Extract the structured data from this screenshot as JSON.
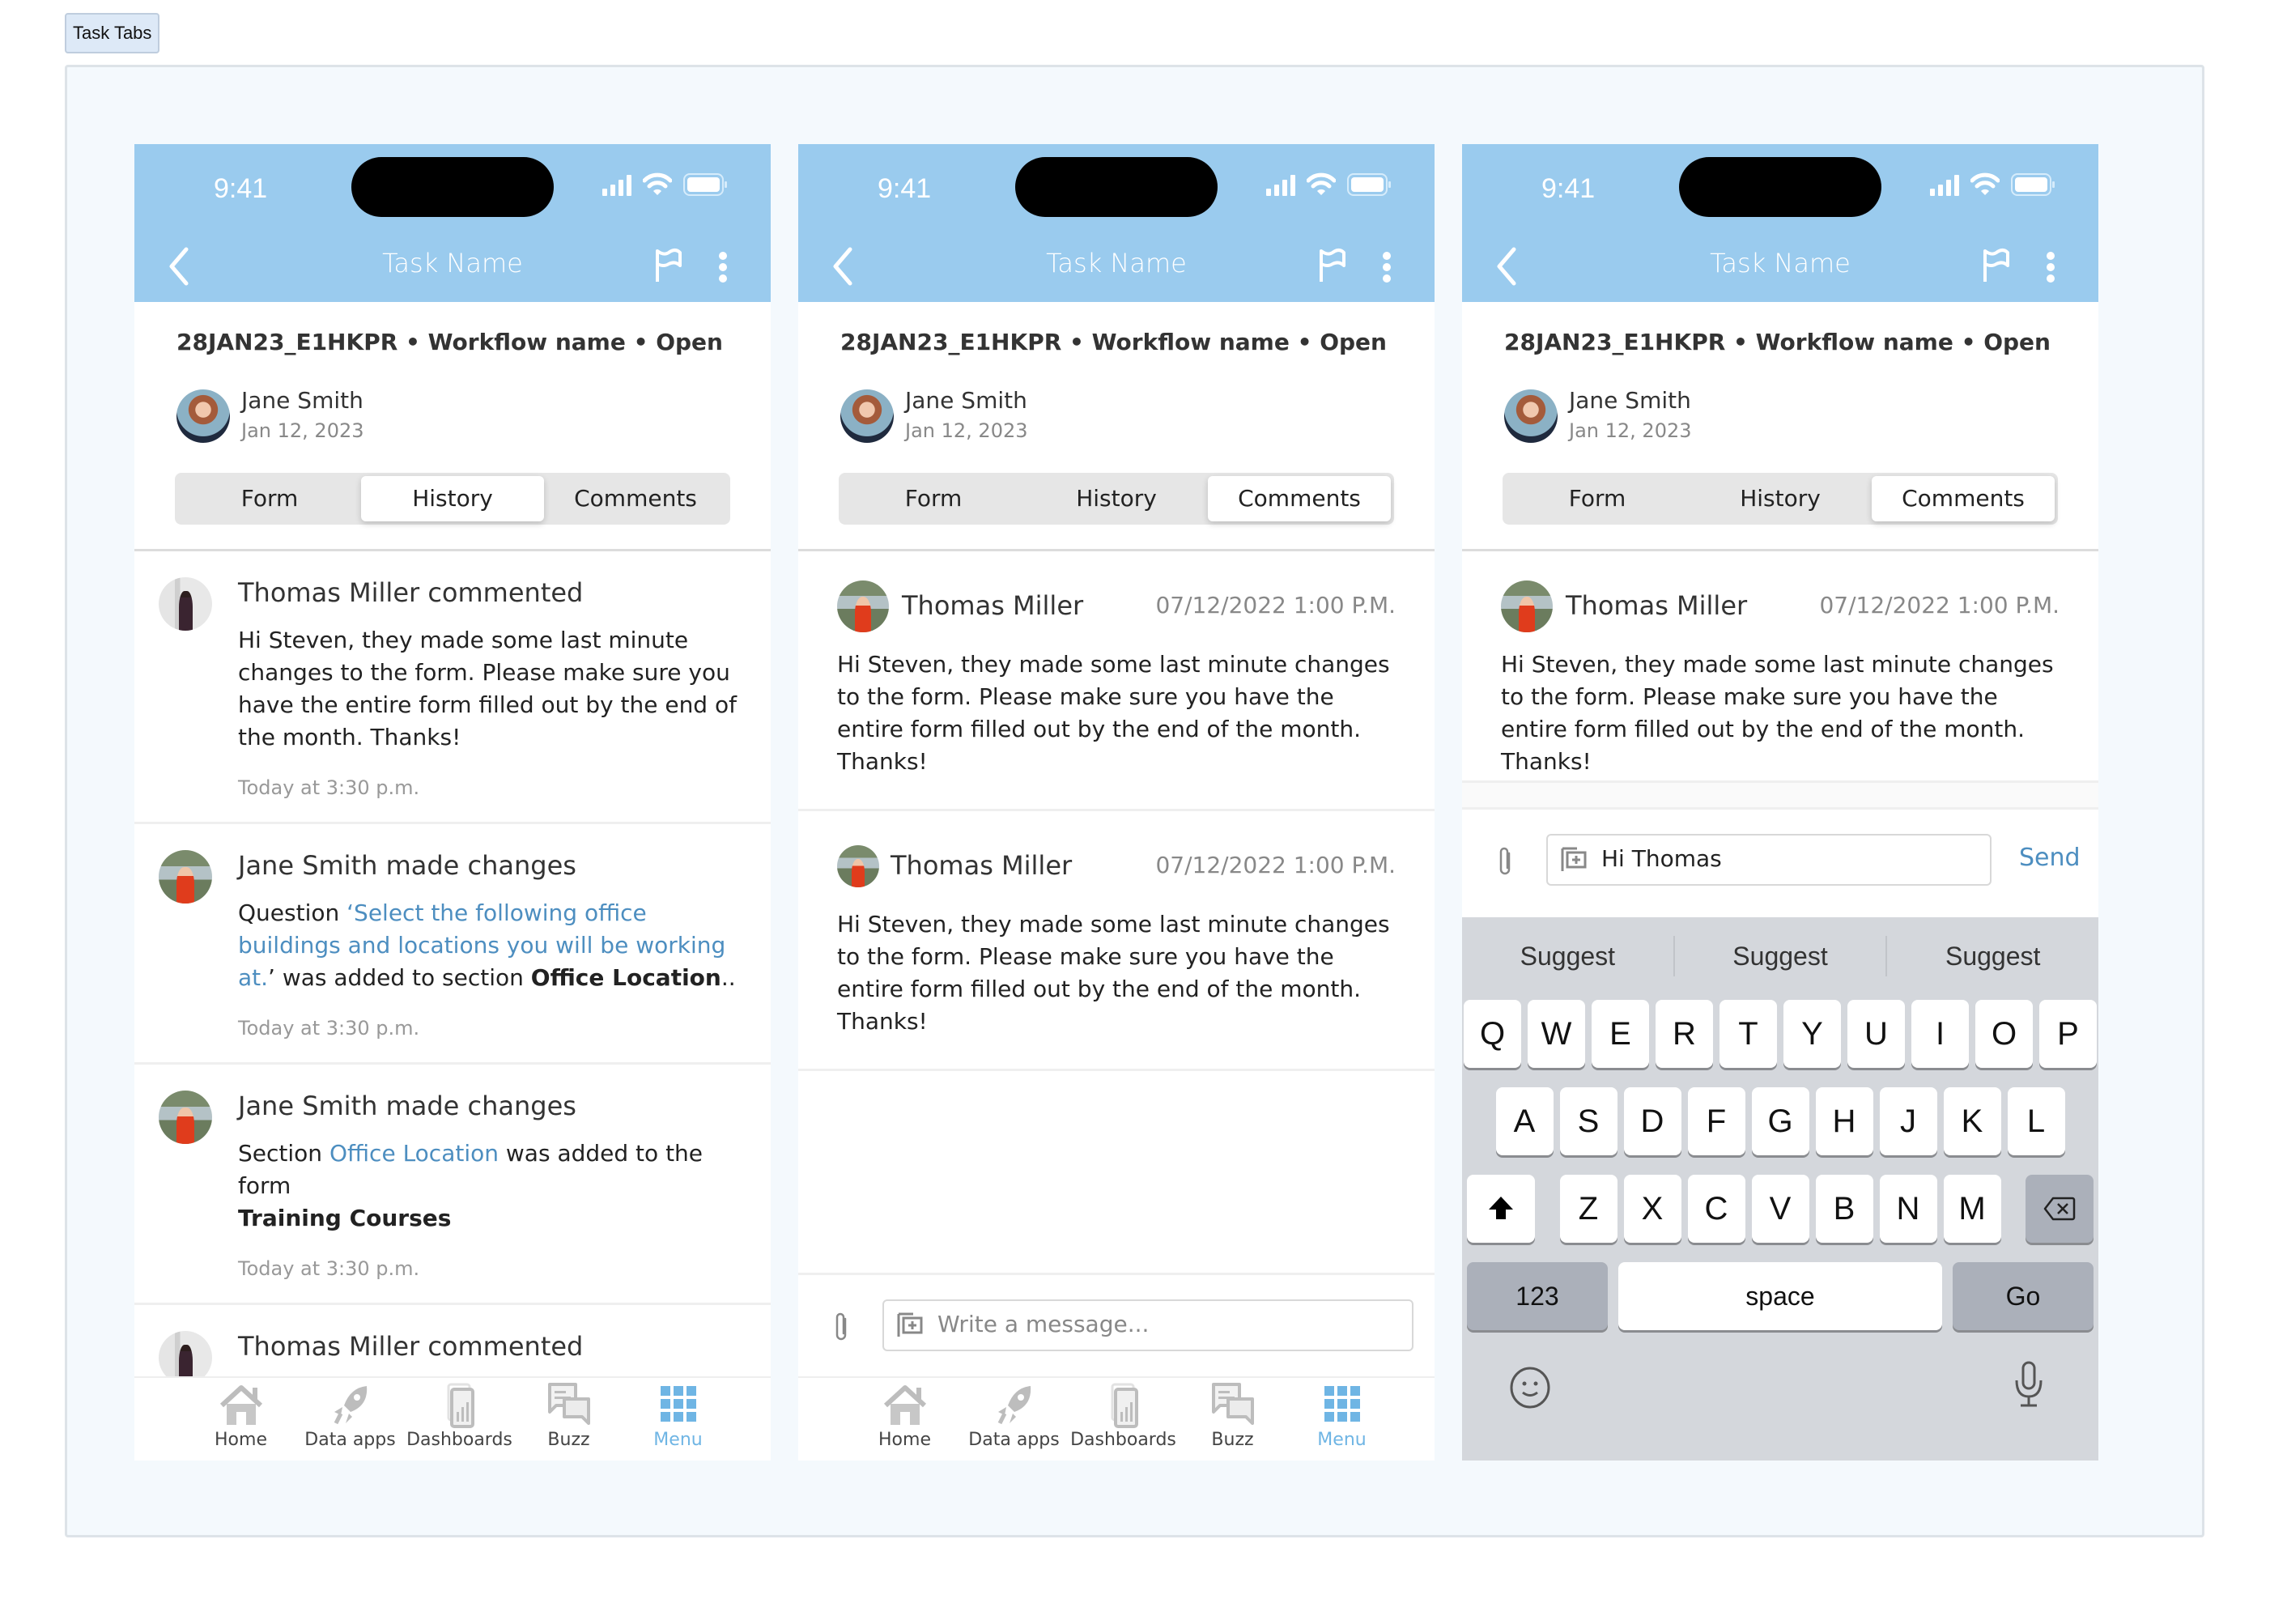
{
  "canvas_label": "Task Tabs",
  "status_bar": {
    "time": "9:41"
  },
  "header": {
    "title": "Task Name"
  },
  "task_meta": {
    "id": "28JAN23_E1HKPR",
    "workflow": "Workflow name",
    "status": "Open",
    "line": "28JAN23_E1HKPR  • Workflow name • Open"
  },
  "submitter": {
    "name": "Jane Smith",
    "date": "Jan 12, 2023"
  },
  "tabs": [
    "Form",
    "History",
    "Comments"
  ],
  "screens": [
    {
      "active_tab": "History"
    },
    {
      "active_tab": "Comments"
    },
    {
      "active_tab": "Comments"
    }
  ],
  "history": [
    {
      "title": "Thomas Miller commented",
      "body": "Hi Steven, they made some last minute changes to the form. Please make sure you have the entire form filled out by the end of the month. Thanks!",
      "time": "Today at 3:30 p.m."
    },
    {
      "title": "Jane Smith made changes",
      "prefix": "Question ",
      "link": "‘Select the following office buildings and locations you will be working at.",
      "middle": "’ was added to section ",
      "bold": "Office Location",
      "suffix": "..",
      "time": "Today at 3:30 p.m."
    },
    {
      "title": "Jane Smith made changes",
      "prefix": "Section ",
      "link": "Office Location",
      "middle": " was added to the form ",
      "bold": "Training Courses",
      "time": "Today at 3:30 p.m."
    },
    {
      "title": "Thomas Miller commented"
    }
  ],
  "comments": [
    {
      "author": "Thomas Miller",
      "date": "07/12/2022 1:00 P.M.",
      "body": "Hi Steven, they made some last minute changes to the form. Please make sure you have the entire form filled out by the end of the month. Thanks!"
    },
    {
      "author": "Thomas Miller",
      "date": "07/12/2022 1:00 P.M.",
      "body": "Hi Steven, they made some last minute changes to the form. Please make sure you have the entire form filled out by the end of the month. Thanks!"
    }
  ],
  "compose": {
    "placeholder": "Write a message...",
    "value": "Hi Thomas",
    "send_label": "Send"
  },
  "nav": [
    {
      "label": "Home",
      "icon": "home-icon"
    },
    {
      "label": "Data apps",
      "icon": "rocket-icon"
    },
    {
      "label": "Dashboards",
      "icon": "dashboard-icon"
    },
    {
      "label": "Buzz",
      "icon": "chat-bubbles-icon"
    },
    {
      "label": "Menu",
      "icon": "grid-menu-icon",
      "active": true
    }
  ],
  "keyboard": {
    "suggestions": [
      "Suggest",
      "Suggest",
      "Suggest"
    ],
    "row1": [
      "Q",
      "W",
      "E",
      "R",
      "T",
      "Y",
      "U",
      "I",
      "O",
      "P"
    ],
    "row2": [
      "A",
      "S",
      "D",
      "F",
      "G",
      "H",
      "J",
      "K",
      "L"
    ],
    "row3": [
      "Z",
      "X",
      "C",
      "V",
      "B",
      "N",
      "M"
    ],
    "numbers_label": "123",
    "space_label": "space",
    "go_label": "Go"
  },
  "colors": {
    "header": "#9acbee",
    "link": "#4d8ec0",
    "nav_active": "#6fb5e4",
    "keyboard_bg": "#d4d7dc"
  }
}
